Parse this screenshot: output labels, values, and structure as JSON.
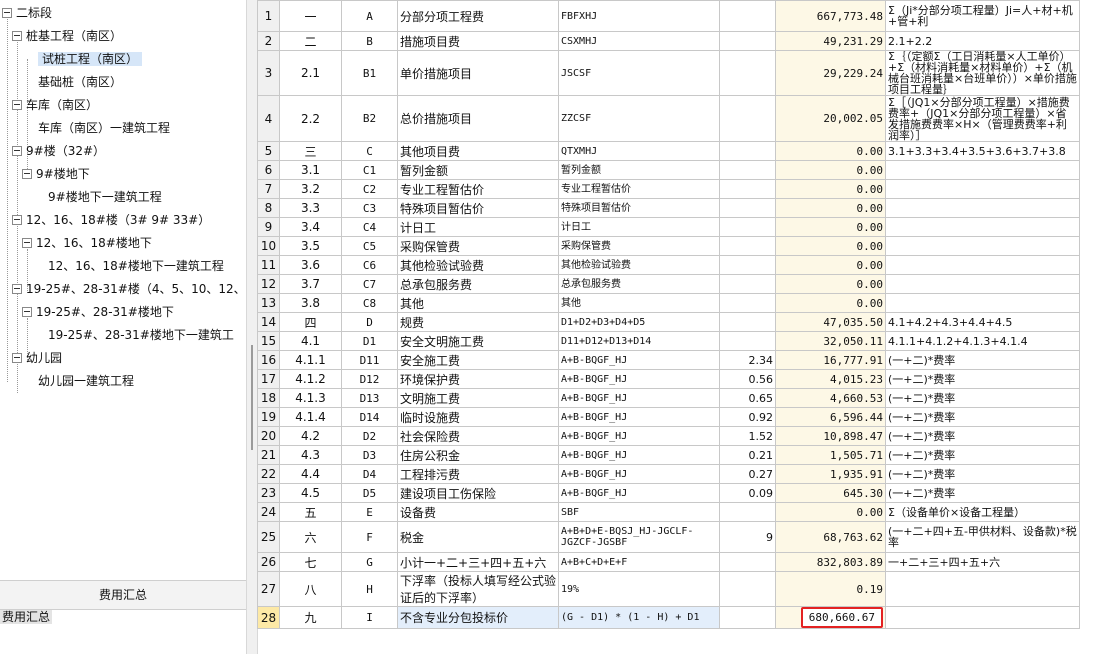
{
  "tree": {
    "nodes": [
      {
        "label": "二标段",
        "box": true
      },
      {
        "label": "桩基工程（南区）",
        "box": true
      },
      {
        "label": "试桩工程（南区）",
        "box": false,
        "selected": true
      },
      {
        "label": "基础桩（南区）",
        "box": false
      },
      {
        "label": "车库（南区）",
        "box": true
      },
      {
        "label": "车库（南区）一建筑工程",
        "box": false
      },
      {
        "label": "9#楼（32#）",
        "box": true
      },
      {
        "label": "9#楼地下",
        "box": true
      },
      {
        "label": "9#楼地下一建筑工程",
        "box": false
      },
      {
        "label": "12、16、18#楼（3# 9# 33#）",
        "box": true
      },
      {
        "label": "12、16、18#楼地下",
        "box": true
      },
      {
        "label": "12、16、18#楼地下一建筑工程",
        "box": false
      },
      {
        "label": "19-25#、28-31#楼（4、5、10、12、",
        "box": true
      },
      {
        "label": "19-25#、28-31#楼地下",
        "box": true
      },
      {
        "label": "19-25#、28-31#楼地下一建筑工",
        "box": false
      },
      {
        "label": "幼儿园",
        "box": true
      },
      {
        "label": "幼儿园一建筑工程",
        "box": false
      }
    ]
  },
  "summary_panel": {
    "header": "费用汇总",
    "item": "费用汇总"
  },
  "table": {
    "rows": [
      {
        "no": "1",
        "seq": "一",
        "code": "A",
        "name": "分部分项工程费",
        "expr": "FBFXHJ",
        "rate": "",
        "amount": "667,773.48",
        "note": "Σ（Ji*分部分项工程量）Ji=人+材+机+管+利"
      },
      {
        "no": "2",
        "seq": "二",
        "code": "B",
        "name": "措施项目费",
        "expr": "CSXMHJ",
        "rate": "",
        "amount": "49,231.29",
        "note": "2.1+2.2"
      },
      {
        "no": "3",
        "seq": "2.1",
        "code": "B1",
        "name": "单价措施项目",
        "expr": "JSCSF",
        "rate": "",
        "amount": "29,229.24",
        "note": "Σ｛（定额Σ（工日消耗量×人工单价）+Σ（材料消耗量×材料单价）+Σ（机械台班消耗量×台班单价））×单价措施项目工程量｝"
      },
      {
        "no": "4",
        "seq": "2.2",
        "code": "B2",
        "name": "总价措施项目",
        "expr": "ZZCSF",
        "rate": "",
        "amount": "20,002.05",
        "note": "Σ［（JQ1×分部分项工程量）×措施费费率+（JQ1×分部分项工程量）×省发措施费费率×H×（管理费费率+利润率）］"
      },
      {
        "no": "5",
        "seq": "三",
        "code": "C",
        "name": "其他项目费",
        "expr": "QTXMHJ",
        "rate": "",
        "amount": "0.00",
        "note": "3.1+3.3+3.4+3.5+3.6+3.7+3.8"
      },
      {
        "no": "6",
        "seq": "3.1",
        "code": "C1",
        "name": "暂列金额",
        "expr": "暂列金额",
        "rate": "",
        "amount": "0.00",
        "note": ""
      },
      {
        "no": "7",
        "seq": "3.2",
        "code": "C2",
        "name": "专业工程暂估价",
        "expr": "专业工程暂估价",
        "rate": "",
        "amount": "0.00",
        "note": ""
      },
      {
        "no": "8",
        "seq": "3.3",
        "code": "C3",
        "name": "特殊项目暂估价",
        "expr": "特殊项目暂估价",
        "rate": "",
        "amount": "0.00",
        "note": ""
      },
      {
        "no": "9",
        "seq": "3.4",
        "code": "C4",
        "name": "计日工",
        "expr": "计日工",
        "rate": "",
        "amount": "0.00",
        "note": ""
      },
      {
        "no": "10",
        "seq": "3.5",
        "code": "C5",
        "name": "采购保管费",
        "expr": "采购保管费",
        "rate": "",
        "amount": "0.00",
        "note": ""
      },
      {
        "no": "11",
        "seq": "3.6",
        "code": "C6",
        "name": "其他检验试验费",
        "expr": "其他检验试验费",
        "rate": "",
        "amount": "0.00",
        "note": ""
      },
      {
        "no": "12",
        "seq": "3.7",
        "code": "C7",
        "name": "总承包服务费",
        "expr": "总承包服务费",
        "rate": "",
        "amount": "0.00",
        "note": ""
      },
      {
        "no": "13",
        "seq": "3.8",
        "code": "C8",
        "name": "其他",
        "expr": "其他",
        "rate": "",
        "amount": "0.00",
        "note": ""
      },
      {
        "no": "14",
        "seq": "四",
        "code": "D",
        "name": "规费",
        "expr": "D1+D2+D3+D4+D5",
        "rate": "",
        "amount": "47,035.50",
        "note": "4.1+4.2+4.3+4.4+4.5"
      },
      {
        "no": "15",
        "seq": "4.1",
        "code": "D1",
        "name": "安全文明施工费",
        "expr": "D11+D12+D13+D14",
        "rate": "",
        "amount": "32,050.11",
        "note": "4.1.1+4.1.2+4.1.3+4.1.4"
      },
      {
        "no": "16",
        "seq": "4.1.1",
        "code": "D11",
        "name": "安全施工费",
        "expr": "A+B-BQGF_HJ",
        "rate": "2.34",
        "amount": "16,777.91",
        "note": "(一+二)*费率"
      },
      {
        "no": "17",
        "seq": "4.1.2",
        "code": "D12",
        "name": "环境保护费",
        "expr": "A+B-BQGF_HJ",
        "rate": "0.56",
        "amount": "4,015.23",
        "note": "(一+二)*费率"
      },
      {
        "no": "18",
        "seq": "4.1.3",
        "code": "D13",
        "name": "文明施工费",
        "expr": "A+B-BQGF_HJ",
        "rate": "0.65",
        "amount": "4,660.53",
        "note": "(一+二)*费率"
      },
      {
        "no": "19",
        "seq": "4.1.4",
        "code": "D14",
        "name": "临时设施费",
        "expr": "A+B-BQGF_HJ",
        "rate": "0.92",
        "amount": "6,596.44",
        "note": "(一+二)*费率"
      },
      {
        "no": "20",
        "seq": "4.2",
        "code": "D2",
        "name": "社会保险费",
        "expr": "A+B-BQGF_HJ",
        "rate": "1.52",
        "amount": "10,898.47",
        "note": "(一+二)*费率"
      },
      {
        "no": "21",
        "seq": "4.3",
        "code": "D3",
        "name": "住房公积金",
        "expr": "A+B-BQGF_HJ",
        "rate": "0.21",
        "amount": "1,505.71",
        "note": "(一+二)*费率"
      },
      {
        "no": "22",
        "seq": "4.4",
        "code": "D4",
        "name": "工程排污费",
        "expr": "A+B-BQGF_HJ",
        "rate": "0.27",
        "amount": "1,935.91",
        "note": "(一+二)*费率"
      },
      {
        "no": "23",
        "seq": "4.5",
        "code": "D5",
        "name": "建设项目工伤保险",
        "expr": "A+B-BQGF_HJ",
        "rate": "0.09",
        "amount": "645.30",
        "note": "(一+二)*费率"
      },
      {
        "no": "24",
        "seq": "五",
        "code": "E",
        "name": "设备费",
        "expr": "SBF",
        "rate": "",
        "amount": "0.00",
        "note": "Σ（设备单价×设备工程量）"
      },
      {
        "no": "25",
        "seq": "六",
        "code": "F",
        "name": "税金",
        "expr": "A+B+D+E-BQSJ_HJ-JGCLF-JGZCF-JGSBF",
        "rate": "9",
        "amount": "68,763.62",
        "note": "(一+二+四+五-甲供材料、设备款)*税率"
      },
      {
        "no": "26",
        "seq": "七",
        "code": "G",
        "name": "小计一+二+三+四+五+六",
        "expr": "A+B+C+D+E+F",
        "rate": "",
        "amount": "832,803.89",
        "note": "一+二+三+四+五+六"
      },
      {
        "no": "27",
        "seq": "八",
        "code": "H",
        "name": "下浮率（投标人填写经公式验证后的下浮率）",
        "expr": "19%",
        "rate": "",
        "amount": "0.19",
        "note": ""
      },
      {
        "no": "28",
        "seq": "九",
        "code": "I",
        "name": "不含专业分包投标价",
        "expr": "(G - D1) * (1 - H) + D1",
        "rate": "",
        "amount": "680,660.67",
        "note": "",
        "current": true,
        "highlight_amount": true
      }
    ]
  },
  "colors": {
    "highlight_border": "#e32222",
    "amount_bg": "#fdf8e6",
    "selection_bg": "#d6e6f8"
  }
}
